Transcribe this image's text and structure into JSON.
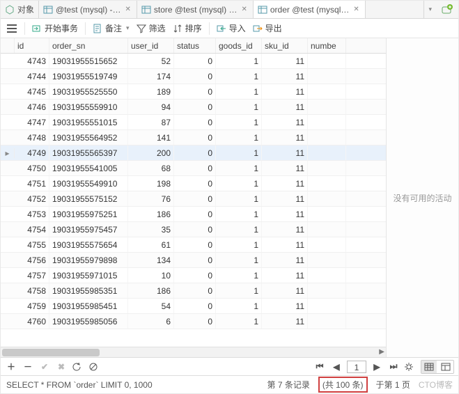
{
  "tabs": [
    {
      "label": "对象"
    },
    {
      "label": "@test (mysql) -…"
    },
    {
      "label": "store @test (mysql) …"
    },
    {
      "label": "order @test (mysql…"
    }
  ],
  "active_tab": 3,
  "toolbar": {
    "begin_tx": "开始事务",
    "memo": "备注",
    "filter": "筛选",
    "sort": "排序",
    "import": "导入",
    "export": "导出"
  },
  "columns": [
    "id",
    "order_sn",
    "user_id",
    "status",
    "goods_id",
    "sku_id",
    "numbe"
  ],
  "rows": [
    {
      "id": 4743,
      "order_sn": "19031955515652",
      "user_id": 52,
      "status": 0,
      "goods_id": 1,
      "sku_id": 11
    },
    {
      "id": 4744,
      "order_sn": "19031955519749",
      "user_id": 174,
      "status": 0,
      "goods_id": 1,
      "sku_id": 11
    },
    {
      "id": 4745,
      "order_sn": "19031955525550",
      "user_id": 189,
      "status": 0,
      "goods_id": 1,
      "sku_id": 11
    },
    {
      "id": 4746,
      "order_sn": "19031955559910",
      "user_id": 94,
      "status": 0,
      "goods_id": 1,
      "sku_id": 11
    },
    {
      "id": 4747,
      "order_sn": "19031955551015",
      "user_id": 87,
      "status": 0,
      "goods_id": 1,
      "sku_id": 11
    },
    {
      "id": 4748,
      "order_sn": "19031955564952",
      "user_id": 141,
      "status": 0,
      "goods_id": 1,
      "sku_id": 11
    },
    {
      "id": 4749,
      "order_sn": "19031955565397",
      "user_id": 200,
      "status": 0,
      "goods_id": 1,
      "sku_id": 11
    },
    {
      "id": 4750,
      "order_sn": "19031955541005",
      "user_id": 68,
      "status": 0,
      "goods_id": 1,
      "sku_id": 11
    },
    {
      "id": 4751,
      "order_sn": "19031955549910",
      "user_id": 198,
      "status": 0,
      "goods_id": 1,
      "sku_id": 11
    },
    {
      "id": 4752,
      "order_sn": "19031955575152",
      "user_id": 76,
      "status": 0,
      "goods_id": 1,
      "sku_id": 11
    },
    {
      "id": 4753,
      "order_sn": "19031955975251",
      "user_id": 186,
      "status": 0,
      "goods_id": 1,
      "sku_id": 11
    },
    {
      "id": 4754,
      "order_sn": "19031955975457",
      "user_id": 35,
      "status": 0,
      "goods_id": 1,
      "sku_id": 11
    },
    {
      "id": 4755,
      "order_sn": "19031955575654",
      "user_id": 61,
      "status": 0,
      "goods_id": 1,
      "sku_id": 11
    },
    {
      "id": 4756,
      "order_sn": "19031955979898",
      "user_id": 134,
      "status": 0,
      "goods_id": 1,
      "sku_id": 11
    },
    {
      "id": 4757,
      "order_sn": "19031955971015",
      "user_id": 10,
      "status": 0,
      "goods_id": 1,
      "sku_id": 11
    },
    {
      "id": 4758,
      "order_sn": "19031955985351",
      "user_id": 186,
      "status": 0,
      "goods_id": 1,
      "sku_id": 11
    },
    {
      "id": 4759,
      "order_sn": "19031955985451",
      "user_id": 54,
      "status": 0,
      "goods_id": 1,
      "sku_id": 11
    },
    {
      "id": 4760,
      "order_sn": "19031955985056",
      "user_id": 6,
      "status": 0,
      "goods_id": 1,
      "sku_id": 11
    }
  ],
  "current_row_index": 6,
  "side_empty_text": "没有可用的活动",
  "nav": {
    "page": "1"
  },
  "status": {
    "sql": "SELECT * FROM `order` LIMIT 0, 1000",
    "record_prefix": "第 7 条记录",
    "record_box": "(共 100 条)",
    "record_suffix": "于第 1 页",
    "watermark": "CTO博客"
  }
}
